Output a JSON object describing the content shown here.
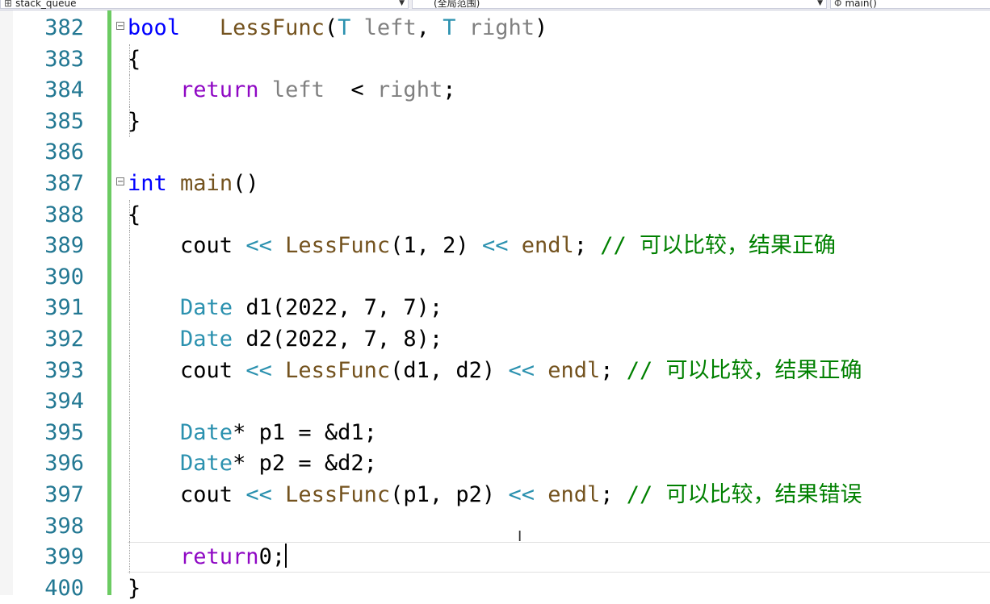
{
  "navbar": {
    "project": "stack_queue",
    "scope": "(全局范围)",
    "member": "main()"
  },
  "lines": [
    {
      "no": "382",
      "tokens": [
        [
          "kw",
          "bool"
        ],
        [
          "",
          ""
        ],
        [
          "",
          ""
        ],
        [
          "",
          ""
        ],
        [
          "fn",
          "LessFunc"
        ],
        [
          "",
          "("
        ],
        [
          "ty",
          "T"
        ],
        [
          "",
          ""
        ],
        [
          "par",
          "left"
        ],
        [
          "",
          ", "
        ],
        [
          "ty",
          "T"
        ],
        [
          "",
          ""
        ],
        [
          "par",
          "right"
        ],
        [
          "",
          ")"
        ]
      ]
    },
    {
      "no": "383",
      "tokens": [
        [
          "",
          "{"
        ]
      ]
    },
    {
      "no": "384",
      "tokens": [
        [
          "",
          "    "
        ],
        [
          "kw2",
          "return"
        ],
        [
          "",
          ""
        ],
        [
          "par",
          "left"
        ],
        [
          "",
          ""
        ],
        [
          "",
          ""
        ],
        [
          "",
          "< "
        ],
        [
          "par",
          "right"
        ],
        [
          "",
          ";"
        ]
      ]
    },
    {
      "no": "385",
      "tokens": [
        [
          "",
          "}"
        ]
      ]
    },
    {
      "no": "386",
      "tokens": []
    },
    {
      "no": "387",
      "tokens": [
        [
          "kw",
          "int"
        ],
        [
          "",
          ""
        ],
        [
          "fn",
          "main"
        ],
        [
          "",
          "()"
        ]
      ]
    },
    {
      "no": "388",
      "tokens": [
        [
          "",
          "{"
        ]
      ]
    },
    {
      "no": "389",
      "tokens": [
        [
          "",
          "    cout "
        ],
        [
          "ty",
          "<<"
        ],
        [
          "",
          ""
        ],
        [
          "fn",
          "LessFunc"
        ],
        [
          "",
          "(1, 2) "
        ],
        [
          "ty",
          "<<"
        ],
        [
          "",
          ""
        ],
        [
          "fn",
          "endl"
        ],
        [
          "",
          "; "
        ],
        [
          "cm",
          "// 可以比较，结果正确"
        ]
      ]
    },
    {
      "no": "390",
      "tokens": []
    },
    {
      "no": "391",
      "tokens": [
        [
          "",
          "    "
        ],
        [
          "ty",
          "Date"
        ],
        [
          "",
          ""
        ],
        [
          "",
          "d1(2022, 7, 7);"
        ]
      ]
    },
    {
      "no": "392",
      "tokens": [
        [
          "",
          "    "
        ],
        [
          "ty",
          "Date"
        ],
        [
          "",
          ""
        ],
        [
          "",
          "d2(2022, 7, 8);"
        ]
      ]
    },
    {
      "no": "393",
      "tokens": [
        [
          "",
          "    cout "
        ],
        [
          "ty",
          "<<"
        ],
        [
          "",
          ""
        ],
        [
          "fn",
          "LessFunc"
        ],
        [
          "",
          "(d1, d2) "
        ],
        [
          "ty",
          "<<"
        ],
        [
          "",
          ""
        ],
        [
          "fn",
          "endl"
        ],
        [
          "",
          "; "
        ],
        [
          "cm",
          "// 可以比较，结果正确"
        ]
      ]
    },
    {
      "no": "394",
      "tokens": []
    },
    {
      "no": "395",
      "tokens": [
        [
          "",
          "    "
        ],
        [
          "ty",
          "Date"
        ],
        [
          "",
          "* p1 = &d1;"
        ]
      ]
    },
    {
      "no": "396",
      "tokens": [
        [
          "",
          "    "
        ],
        [
          "ty",
          "Date"
        ],
        [
          "",
          "* p2 = &d2;"
        ]
      ]
    },
    {
      "no": "397",
      "tokens": [
        [
          "",
          "    cout "
        ],
        [
          "ty",
          "<<"
        ],
        [
          "",
          ""
        ],
        [
          "fn",
          "LessFunc"
        ],
        [
          "",
          "(p1, p2) "
        ],
        [
          "ty",
          "<<"
        ],
        [
          "",
          ""
        ],
        [
          "fn",
          "endl"
        ],
        [
          "",
          "; "
        ],
        [
          "cm",
          "// 可以比较，结果错误"
        ]
      ]
    },
    {
      "no": "398",
      "tokens": []
    },
    {
      "no": "399",
      "tokens": [
        [
          "",
          "    "
        ],
        [
          "kw2",
          "return"
        ],
        [
          "",
          "0;"
        ]
      ]
    },
    {
      "no": "400",
      "tokens": [
        [
          "",
          "}"
        ]
      ]
    }
  ]
}
